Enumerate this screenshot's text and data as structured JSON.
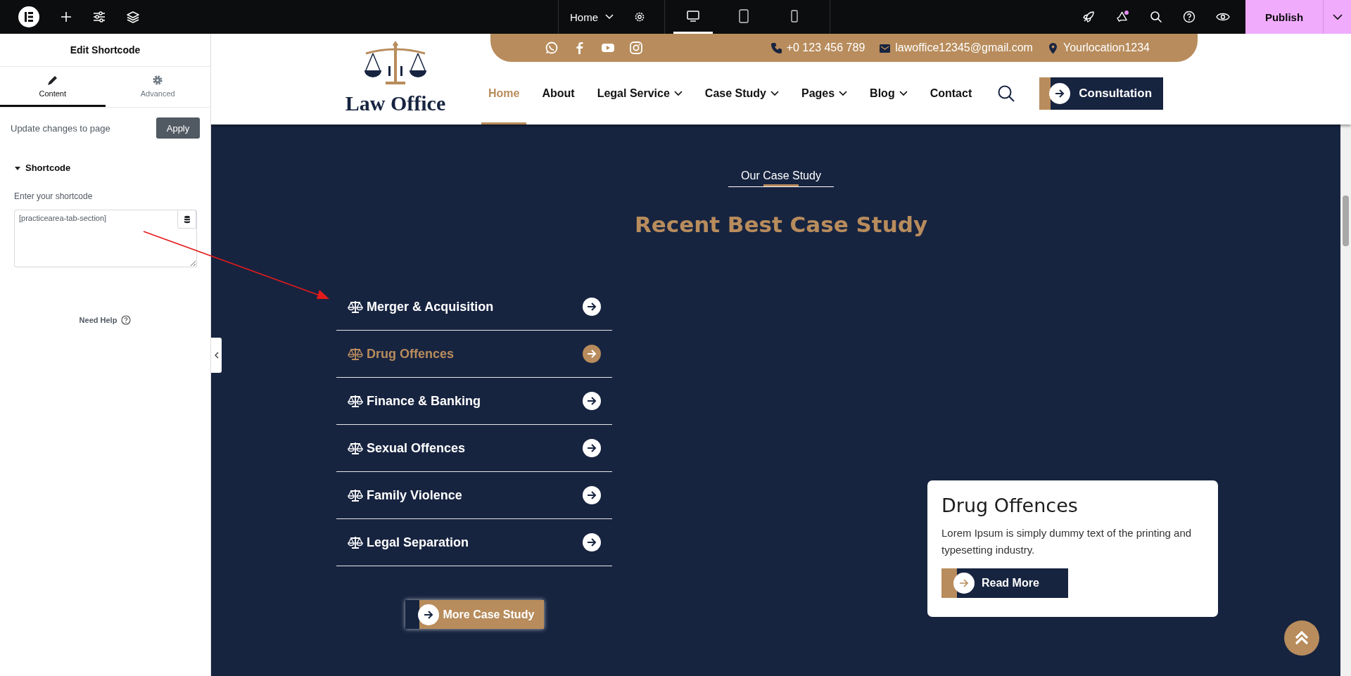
{
  "editor_bar": {
    "page_menu": "Home",
    "publish": "Publish",
    "devices": [
      {
        "kind": "desktop",
        "selected": true
      },
      {
        "kind": "tablet",
        "selected": false
      },
      {
        "kind": "mobile",
        "selected": false
      }
    ]
  },
  "panel": {
    "title": "Edit Shortcode",
    "tabs": [
      {
        "label": "Content",
        "kind": "pencil",
        "selected": true
      },
      {
        "label": "Advanced",
        "kind": "gear",
        "selected": false
      }
    ],
    "update_label": "Update changes to page",
    "apply": "Apply",
    "section": {
      "title": "Shortcode",
      "expanded": true
    },
    "field_label": "Enter your shortcode",
    "field_value": "[practicearea-tab-section]",
    "help": "Need Help"
  },
  "site": {
    "logo": "Law Office",
    "socials": [
      {
        "kind": "whatsapp"
      },
      {
        "kind": "facebook"
      },
      {
        "kind": "youtube"
      },
      {
        "kind": "instagram"
      }
    ],
    "contacts": [
      {
        "kind": "phone",
        "text": "+0 123 456 789"
      },
      {
        "kind": "email",
        "text": "lawoffice12345@gmail.com"
      },
      {
        "kind": "location",
        "text": "Yourlocation1234"
      }
    ],
    "nav": [
      {
        "label": "Home",
        "selected": true,
        "dropdown": false
      },
      {
        "label": "About",
        "selected": false,
        "dropdown": false
      },
      {
        "label": "Legal Service",
        "selected": false,
        "dropdown": true
      },
      {
        "label": "Case Study",
        "selected": false,
        "dropdown": true
      },
      {
        "label": "Pages",
        "selected": false,
        "dropdown": true
      },
      {
        "label": "Blog",
        "selected": false,
        "dropdown": true
      },
      {
        "label": "Contact",
        "selected": false,
        "dropdown": false
      }
    ],
    "cta": "Consultation"
  },
  "section": {
    "eyebrow": "Our Case Study",
    "heading": "Recent Best Case Study",
    "cases": [
      {
        "label": "Merger & Acquisition",
        "selected": false
      },
      {
        "label": "Drug Offences",
        "selected": true
      },
      {
        "label": "Finance & Banking",
        "selected": false
      },
      {
        "label": "Sexual Offences",
        "selected": false
      },
      {
        "label": "Family Violence",
        "selected": false
      },
      {
        "label": "Legal Separation",
        "selected": false
      }
    ],
    "more": "More Case Study",
    "card": {
      "title": "Drug Offences",
      "text": "Lorem Ipsum is simply dummy text of the printing and typesetting industry.",
      "button": "Read More"
    }
  }
}
